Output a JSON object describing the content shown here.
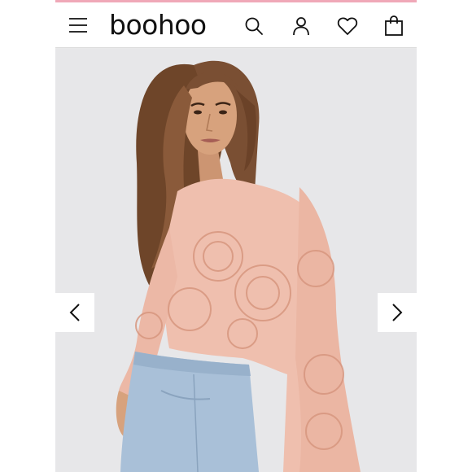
{
  "brand": {
    "logo_text": "boohoo",
    "accent_color": "#f0a8b8"
  },
  "header": {
    "menu_icon": "hamburger-menu-icon",
    "search_icon": "search-icon",
    "account_icon": "user-icon",
    "wishlist_icon": "heart-icon",
    "bag_icon": "shopping-bag-icon"
  },
  "product_gallery": {
    "image_description_icon": "product-photo",
    "prev_icon": "chevron-left-icon",
    "next_icon": "chevron-right-icon",
    "colors": {
      "top": "#efbfae",
      "jeans": "#a9c0d8",
      "hair": "#7a4f33",
      "skin": "#d7a27d"
    }
  }
}
